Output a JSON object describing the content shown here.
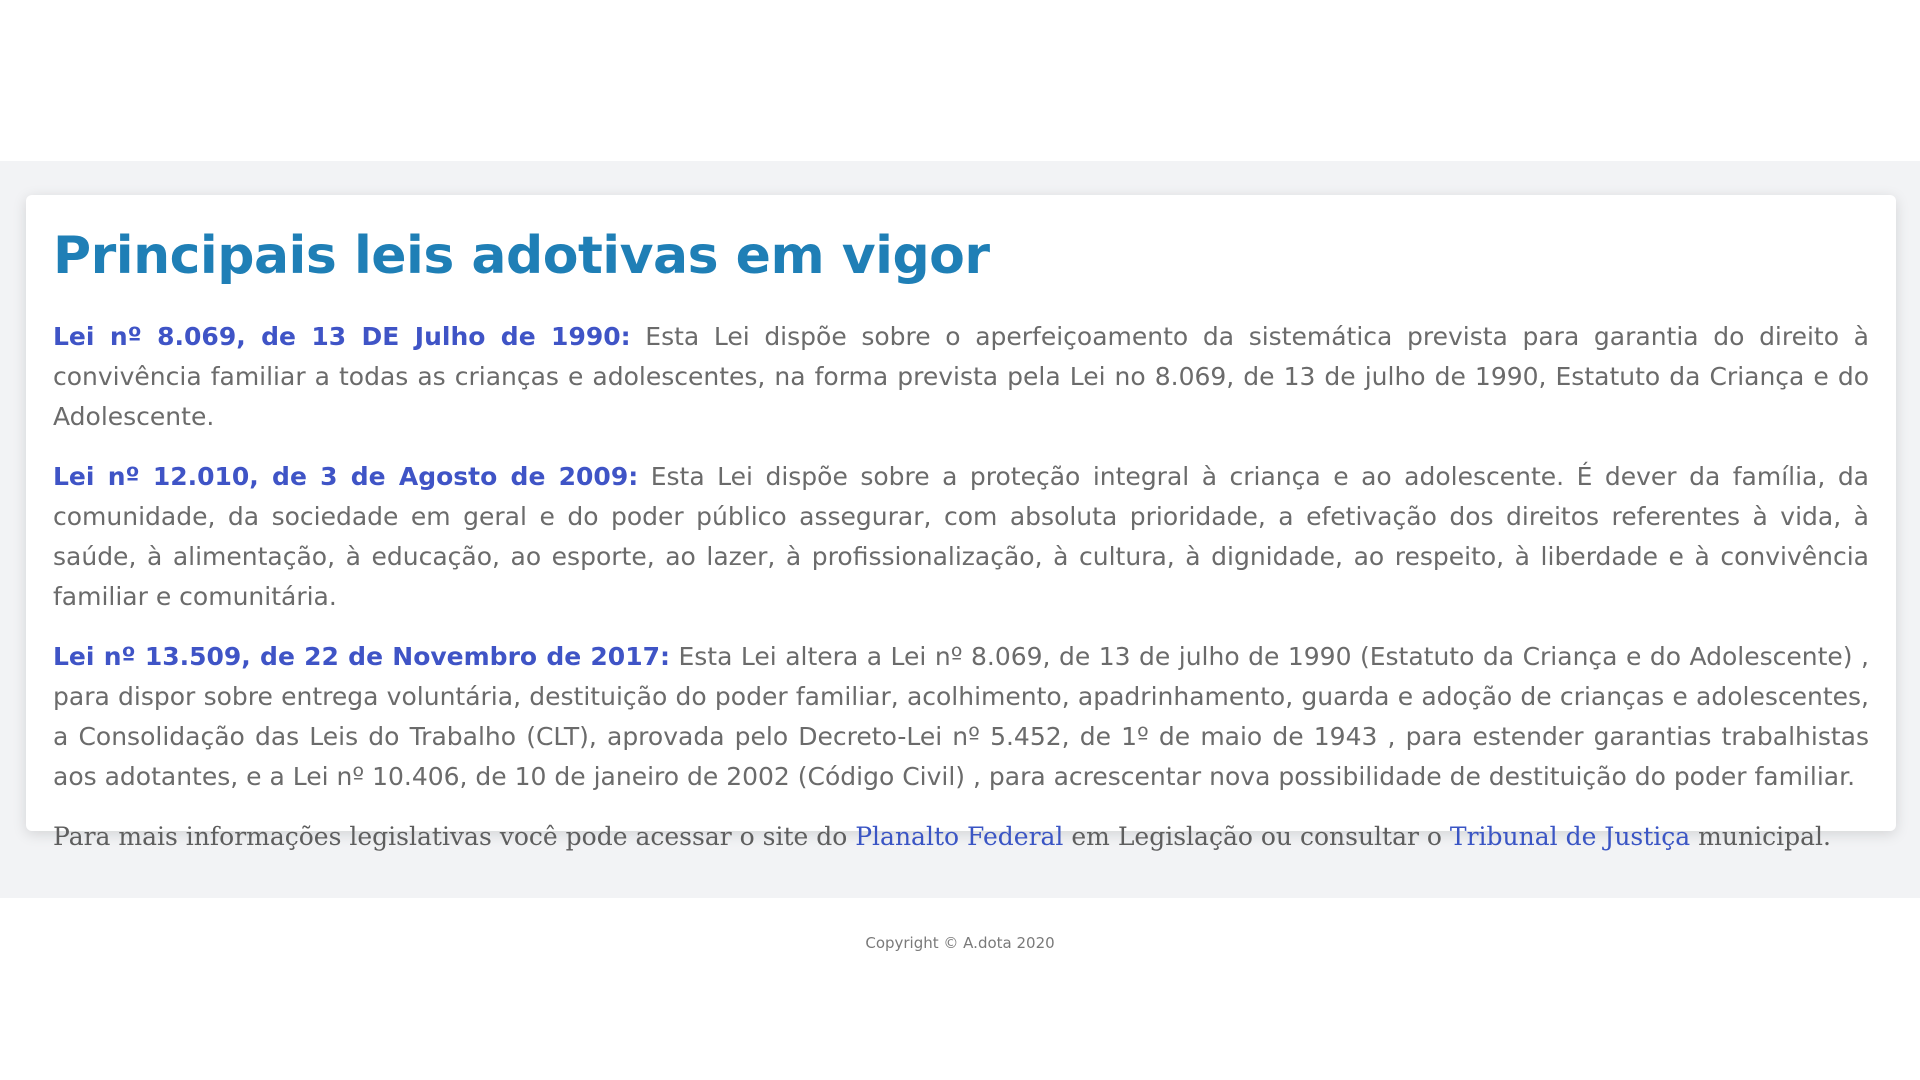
{
  "main": {
    "title": "Principais leis adotivas em vigor",
    "laws": [
      {
        "title": "Lei nº 8.069, de 13 DE Julho de 1990:",
        "text": " Esta Lei dispõe sobre o aperfeiçoamento da sistemática prevista para garantia do direito à convivência familiar a todas as crianças e adolescentes, na forma prevista pela Lei no 8.069, de 13 de julho de 1990, Estatuto da Criança e do Adolescente."
      },
      {
        "title": "Lei nº 12.010, de 3 de Agosto de 2009:",
        "text": " Esta Lei dispõe sobre a proteção integral à criança e ao adolescente. É dever da família, da comunidade, da sociedade em geral e do poder público assegurar, com absoluta prioridade, a efetivação dos direitos referentes à vida, à saúde, à alimentação, à educação, ao esporte, ao lazer, à profissionalização, à cultura, à dignidade, ao respeito, à liberdade e à convivência familiar e comunitária."
      },
      {
        "title": "Lei nº 13.509, de 22 de Novembro de 2017:",
        "text": " Esta Lei altera a Lei nº 8.069, de 13 de julho de 1990 (Estatuto da Criança e do Adolescente) , para dispor sobre entrega voluntária, destituição do poder familiar, acolhimento, apadrinhamento, guarda e adoção de crianças e adolescentes, a Consolidação das Leis do Trabalho (CLT), aprovada pelo Decreto-Lei nº 5.452, de 1º de maio de 1943 , para estender garantias trabalhistas aos adotantes, e a Lei nº 10.406, de 10 de janeiro de 2002 (Código Civil) , para acrescentar nova possibilidade de destituição do poder familiar."
      }
    ],
    "info": {
      "prefix": "Para mais informações legislativas você pode acessar o site do ",
      "link1": "Planalto Federal",
      "middle": " em Legislação ou consultar o ",
      "link2": "Tribunal de Justiça",
      "suffix": " municipal."
    }
  },
  "footer": {
    "copyright": "Copyright © A.dota 2020"
  },
  "colors": {
    "title": "#1f7fb6",
    "law_title": "#3f54c6",
    "body_text": "#6b6b6b",
    "link": "#3a55c4",
    "band_background": "#f2f3f5"
  }
}
